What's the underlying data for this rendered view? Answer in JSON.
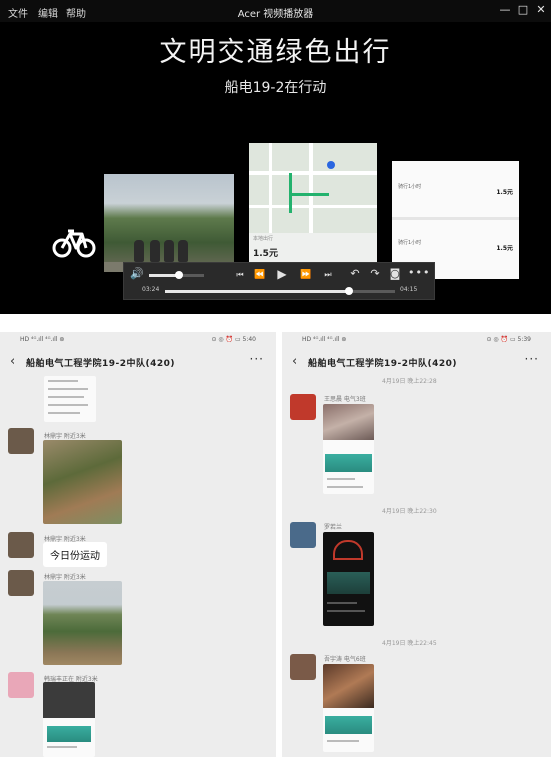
{
  "player": {
    "menu": [
      "文件",
      "编辑",
      "帮助"
    ],
    "window_title": "Acer 视频播放器",
    "window_buttons": {
      "minimize": "—",
      "maximize": "□",
      "close": "✕"
    },
    "headline": "文明交通绿色出行",
    "subline": "船电19-2在行动",
    "map_card": {
      "price": "1.5元",
      "caption": "本地出行"
    },
    "trip_card": {
      "trips": [
        {
          "label": "骑行1小时",
          "amount": "1.5元"
        },
        {
          "label": "骑行1小时",
          "amount": "1.5元"
        }
      ]
    },
    "controls": {
      "current_time": "03:24",
      "total_time": "04:15",
      "progress_fraction": 0.8,
      "volume_fraction": 0.55
    }
  },
  "chat_left": {
    "status_left": "HD ⁴ᴳ.ıll ⁴ᴳ.ıll ⊛",
    "status_right": "⊙ ◎ ⏰ ▭ 5:40",
    "group_name": "船舶电气工程学院19-2中队(420)",
    "messages": [
      {
        "sender": "林鼎宇 附近3米"
      },
      {
        "sender": "林鼎宇 附近3米",
        "text": "今日份运动"
      },
      {
        "sender": "林鼎宇 附近3米"
      },
      {
        "sender": "韩瑞丰正在 附近3米"
      }
    ]
  },
  "chat_right": {
    "status_left": "HD ⁴ᴳ.ıll ⁴ᴳ.ıll ⊛",
    "status_right": "⊙ ◎ ⏰ ▭ 5:39",
    "group_name": "船舶电气工程学院19-2中队(420)",
    "timestamps": [
      "4月19日 晚上22:28",
      "4月19日 晚上22:30",
      "4月19日 晚上22:45"
    ],
    "senders": [
      "王思晨 电气3班",
      "罗若兰",
      "吾宇涛 电气6班"
    ]
  }
}
